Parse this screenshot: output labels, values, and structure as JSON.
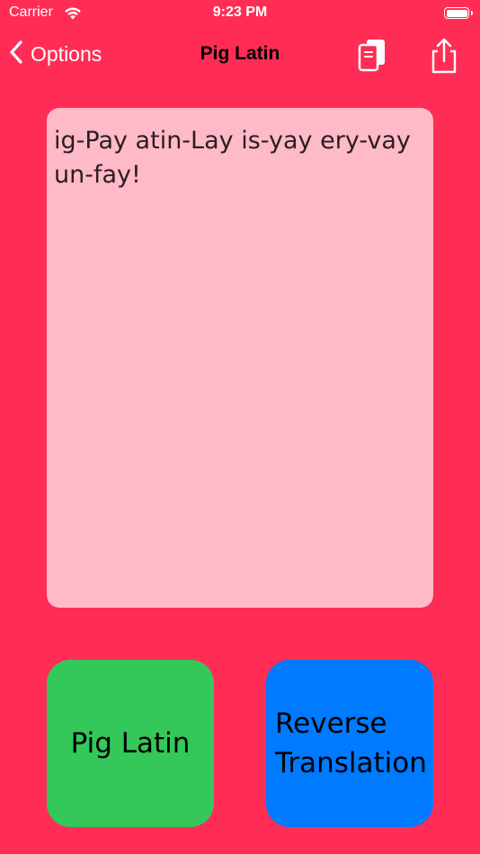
{
  "status_bar": {
    "carrier": "Carrier",
    "time": "9:23 PM"
  },
  "nav": {
    "back_label": "Options",
    "title": "Pig Latin",
    "back_icon": "chevron-left-icon",
    "copy_icon": "copy-icon",
    "share_icon": "share-icon"
  },
  "translation": {
    "text": "ig-Pay atin-Lay is-yay ery-vay un-fay!"
  },
  "buttons": {
    "pig_latin": "Pig Latin",
    "reverse_line1": "Reverse",
    "reverse_line2": "Translation"
  },
  "colors": {
    "background": "#ff2d55",
    "text_area": "#ffbac7",
    "pig_latin_button": "#34c759",
    "reverse_button": "#007aff"
  }
}
